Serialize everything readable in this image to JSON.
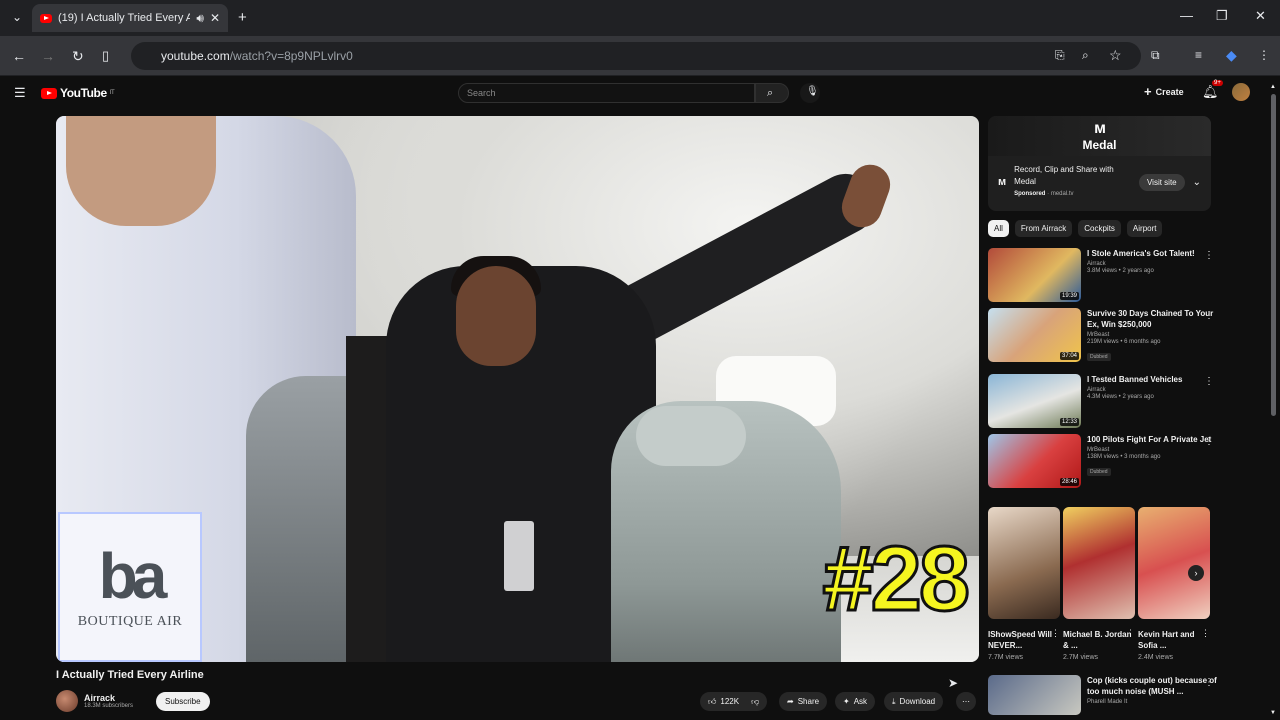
{
  "browser": {
    "tab_title": "(19) I Actually Tried Every A",
    "url_host": "youtube.com",
    "url_path": "/watch?v=8p9NPLvlrv0",
    "new_tab_icon": "plus-icon"
  },
  "youtube": {
    "logo_text": "YouTube",
    "logo_country": "IT",
    "search_placeholder": "Search",
    "create_label": "Create",
    "notif_count": "9+"
  },
  "video": {
    "overlay_number": "#28",
    "overlay_brand": "BOUTIQUE AIR",
    "overlay_mark": "ba",
    "title": "I Actually Tried Every Airline",
    "channel": "Airrack",
    "subscribers": "18.3M subscribers",
    "subscribe_label": "Subscribe",
    "likes": "122K",
    "share_label": "Share",
    "ask_label": "Ask",
    "download_label": "Download"
  },
  "ad": {
    "brand": "Medal",
    "headline": "Record, Clip and Share with Medal",
    "sponsored": "Sponsored",
    "domain": "medal.tv",
    "visit_label": "Visit site"
  },
  "chips": [
    "All",
    "From Airrack",
    "Cockpits",
    "Airport"
  ],
  "recommendations": [
    {
      "title": "I Stole America's Got Talent!",
      "channel": "Airrack",
      "meta": "3.8M views • 2 years ago",
      "duration": "19:39",
      "dubbed": ""
    },
    {
      "title": "Survive 30 Days Chained To Your Ex, Win $250,000",
      "channel": "MrBeast",
      "meta": "219M views • 6 months ago",
      "duration": "37:04",
      "dubbed": "Dubbed"
    },
    {
      "title": "I Tested Banned Vehicles",
      "channel": "Airrack",
      "meta": "4.3M views • 2 years ago",
      "duration": "12:33",
      "dubbed": ""
    },
    {
      "title": "100 Pilots Fight For A Private Jet",
      "channel": "MrBeast",
      "meta": "138M views • 3 months ago",
      "duration": "28:46",
      "dubbed": "Dubbed"
    }
  ],
  "shorts": [
    {
      "title": "IShowSpeed Will NEVER...",
      "views": "7.7M views"
    },
    {
      "title": "Michael B. Jordan & ...",
      "views": "2.7M views"
    },
    {
      "title": "Kevin Hart and Sofia ...",
      "views": "2.4M views"
    }
  ],
  "next_rec": {
    "title": "Cop (kicks couple out) because of too much noise (MUSH ...",
    "channel": "Pharell Made It"
  }
}
